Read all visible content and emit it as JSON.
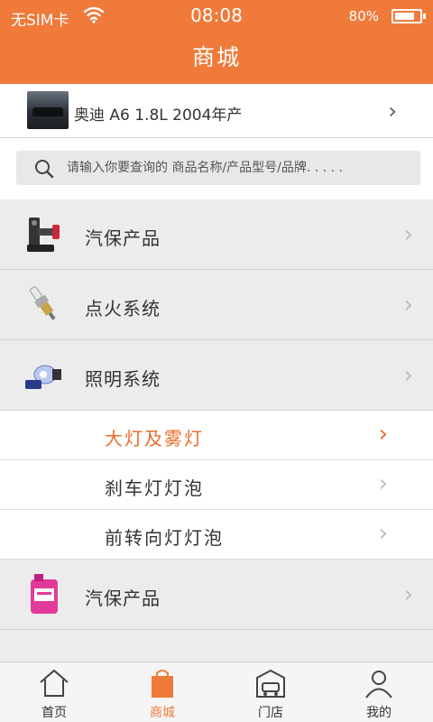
{
  "status_bar": {
    "carrier": "无SIM卡",
    "time": "08:08",
    "battery": "80%",
    "battery_level": 0.8
  },
  "header": {
    "title": "商城"
  },
  "car": {
    "name": "奥迪 A6 1.8L 2004年产"
  },
  "search": {
    "placeholder": "请输入你要查询的 商品名称/产品型号/品牌. . . . ."
  },
  "categories": [
    {
      "label": "汽保产品",
      "icon": "car-lift-icon"
    },
    {
      "label": "点火系统",
      "icon": "spark-plug-icon"
    },
    {
      "label": "照明系统",
      "icon": "headlight-bulb-icon"
    }
  ],
  "subcategories": [
    {
      "label": "大灯及雾灯",
      "active": true
    },
    {
      "label": "刹车灯灯泡",
      "active": false
    },
    {
      "label": "前转向灯灯泡",
      "active": false
    }
  ],
  "category_last": {
    "label": "汽保产品",
    "icon": "cleaner-bottle-icon"
  },
  "tabs": [
    {
      "label": "首页",
      "icon": "home-icon"
    },
    {
      "label": "商城",
      "icon": "shopping-bag-icon",
      "active": true
    },
    {
      "label": "门店",
      "icon": "store-icon"
    },
    {
      "label": "我的",
      "icon": "user-icon"
    }
  ],
  "colors": {
    "accent": "#f07a3a",
    "active_text": "#e86c2c"
  }
}
